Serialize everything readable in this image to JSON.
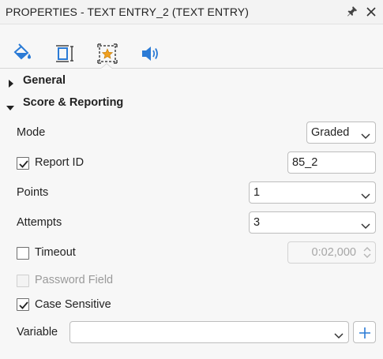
{
  "panel": {
    "title": "PROPERTIES - TEXT ENTRY_2 (TEXT ENTRY)",
    "pin_icon": "pin-icon",
    "close_icon": "close-icon"
  },
  "tabs": [
    {
      "name": "fill-style",
      "icon": "paint-bucket-icon",
      "active": false
    },
    {
      "name": "size-position",
      "icon": "resize-box-icon",
      "active": false
    },
    {
      "name": "score-reporting",
      "icon": "star-box-icon",
      "active": true
    },
    {
      "name": "audio",
      "icon": "speaker-icon",
      "active": false
    }
  ],
  "sections": {
    "general": {
      "label": "General",
      "expanded": false
    },
    "score": {
      "label": "Score & Reporting",
      "expanded": true
    }
  },
  "fields": {
    "mode": {
      "label": "Mode",
      "value": "Graded"
    },
    "report_id": {
      "label": "Report ID",
      "checked": true,
      "value": "85_2"
    },
    "points": {
      "label": "Points",
      "value": "1"
    },
    "attempts": {
      "label": "Attempts",
      "value": "3"
    },
    "timeout": {
      "label": "Timeout",
      "checked": false,
      "value": "0:02,000"
    },
    "password": {
      "label": "Password Field",
      "checked": false,
      "disabled": true
    },
    "case_sensitive": {
      "label": "Case Sensitive",
      "checked": true
    },
    "variable": {
      "label": "Variable",
      "value": ""
    }
  },
  "colors": {
    "accent_blue": "#2b7bd6",
    "star_orange": "#f0a020",
    "text": "#222222",
    "disabled_text": "#9a9a9a",
    "border": "#bdbdbd"
  }
}
